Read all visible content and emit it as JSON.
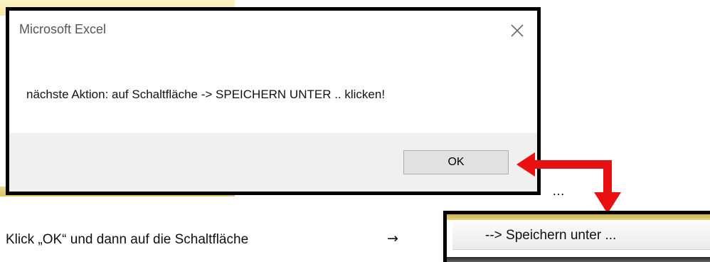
{
  "dialog": {
    "title": "Microsoft Excel",
    "message": "nächste Aktion: auf Schaltfläche -> SPEICHERN UNTER .. klicken!",
    "ok_label": "OK",
    "close_icon": "close-icon"
  },
  "annotation": {
    "ellipsis": "…",
    "instruction": "Klick „OK“ und dann auf die Schaltfläche",
    "arrow_glyph": "→",
    "arrow_color": "#e81010"
  },
  "snippet": {
    "button_label": "--> Speichern unter ..."
  }
}
